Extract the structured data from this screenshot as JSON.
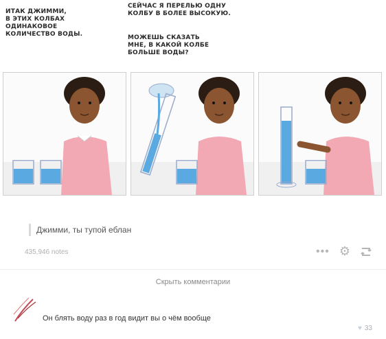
{
  "comic": {
    "caption_left": "ИТАК ДЖИММИ,\nВ ЭТИХ КОЛБАХ\nОДИНАКОВОЕ\nКОЛИЧЕСТВО ВОДЫ.",
    "caption_right_1": "СЕЙЧАС Я ПЕРЕЛЬЮ ОДНУ\nКОЛБУ В БОЛЕЕ ВЫСОКУЮ.",
    "caption_right_2": "МОЖЕШЬ СКАЗАТЬ\nМНЕ, В КАКОЙ КОЛБЕ\nБОЛЬШЕ ВОДЫ?"
  },
  "post": {
    "quote": "Джимми, ты тупой еблан",
    "notes": "435,946 notes",
    "icons": [
      "more-icon",
      "gear-icon",
      "reblog-icon"
    ]
  },
  "comments": {
    "toggle_label": "Скрыть комментарии",
    "items": [
      {
        "text": "Он блять воду раз в год видит вы о чём вообще",
        "likes": "33"
      }
    ]
  },
  "colors": {
    "water": "#5aa9e0",
    "shirt": "#f2a9b4",
    "skin": "#8a5530"
  }
}
